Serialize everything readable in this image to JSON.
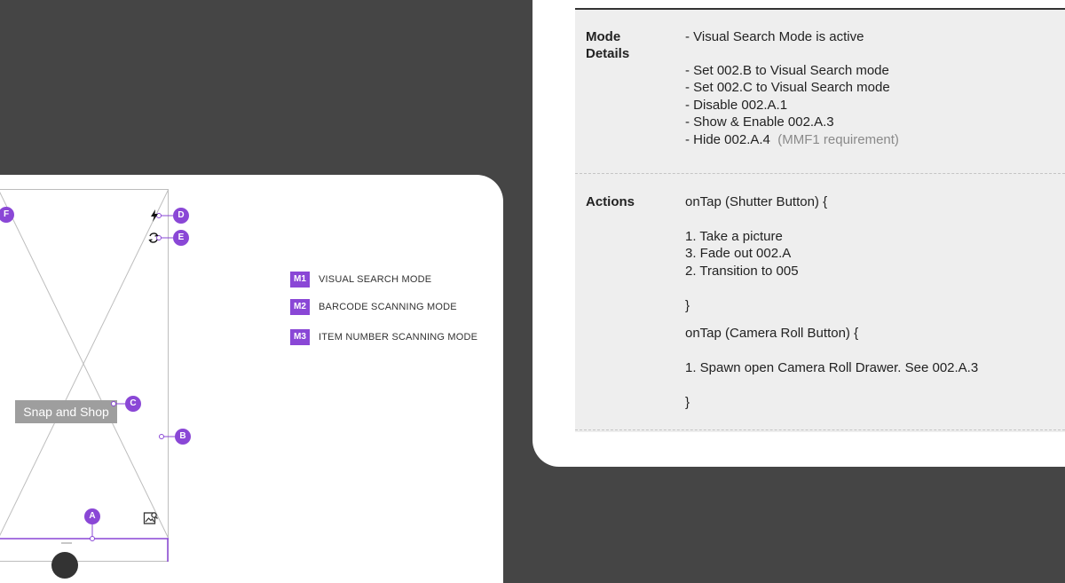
{
  "wireframe": {
    "snap_label": "Snap and Shop",
    "markers": {
      "a": "A",
      "b": "B",
      "c": "C",
      "d": "D",
      "e": "E",
      "f": "F"
    },
    "icons": {
      "flash": "flash-icon",
      "flip": "camera-flip-icon",
      "gallery": "gallery-icon"
    }
  },
  "legend": [
    {
      "badge": "M1",
      "label": "VISUAL SEARCH MODE"
    },
    {
      "badge": "M2",
      "label": "BARCODE SCANNING MODE"
    },
    {
      "badge": "M3",
      "label": "ITEM NUMBER SCANNING MODE"
    }
  ],
  "spec": {
    "mode_details": {
      "label_line1": "Mode",
      "label_line2": "Details",
      "lines": [
        "- Visual Search Mode is active",
        "- Set 002.B to Visual Search mode",
        "- Set 002.C to Visual Search mode",
        "- Disable 002.A.1",
        "- Show & Enable 002.A.3",
        "- Hide 002.A.4"
      ],
      "note": "(MMF1 requirement)"
    },
    "actions": {
      "label": "Actions",
      "lines": [
        "onTap (Shutter Button) {",
        "1. Take a picture",
        "3. Fade out 002.A",
        "2. Transition to 005",
        "}",
        "onTap (Camera Roll Button) {",
        "1. Spawn open Camera Roll Drawer. See 002.A.3",
        "}"
      ]
    }
  },
  "colors": {
    "accent": "#8a47d6",
    "background": "#454545",
    "table": "#eeeeee"
  }
}
